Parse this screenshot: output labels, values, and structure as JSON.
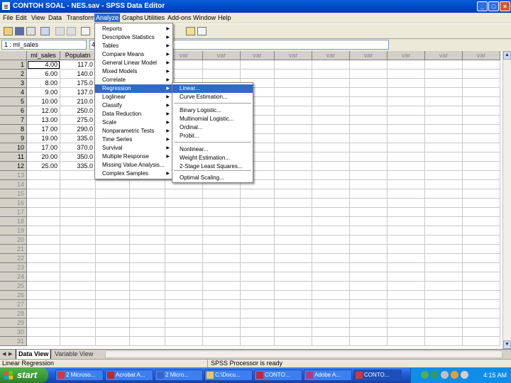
{
  "window": {
    "title": "CONTOH SOAL - NES.sav - SPSS Data Editor",
    "minimize": "_",
    "restore": "□",
    "close": "×"
  },
  "menubar": [
    "File",
    "Edit",
    "View",
    "Data",
    "Transform",
    "Analyze",
    "Graphs",
    "Utilities",
    "Add-ons",
    "Window",
    "Help"
  ],
  "active_menu": "Analyze",
  "cell_editor": {
    "ref": "1 : ml_sales",
    "value": "4"
  },
  "grid": {
    "columns": [
      "ml_sales",
      "Populatn",
      "var",
      "var",
      "var",
      "var",
      "var",
      "var",
      "var",
      "var",
      "var",
      "var",
      "var"
    ],
    "rows": [
      [
        "4.00",
        "117.0"
      ],
      [
        "6.00",
        "140.0"
      ],
      [
        "8.00",
        "175.0"
      ],
      [
        "9.00",
        "137.0"
      ],
      [
        "10.00",
        "210.0"
      ],
      [
        "12.00",
        "250.0"
      ],
      [
        "13.00",
        "275.0"
      ],
      [
        "17.00",
        "290.0"
      ],
      [
        "19.00",
        "335.0"
      ],
      [
        "17.00",
        "370.0"
      ],
      [
        "20.00",
        "350.0"
      ],
      [
        "25.00",
        "335.0"
      ]
    ],
    "row_numbers": [
      "1",
      "2",
      "3",
      "4",
      "5",
      "6",
      "7",
      "8",
      "9",
      "10",
      "11",
      "12",
      "13",
      "14",
      "15",
      "16",
      "17",
      "18",
      "19",
      "20",
      "21",
      "22",
      "23",
      "24",
      "25",
      "26",
      "27",
      "28",
      "29",
      "30",
      "31"
    ]
  },
  "analyze_menu": {
    "items": [
      "Reports",
      "Descriptive Statistics",
      "Tables",
      "Compare Means",
      "General Linear Model",
      "Mixed Models",
      "Correlate",
      "Regression",
      "Loglinear",
      "Classify",
      "Data Reduction",
      "Scale",
      "Nonparametric Tests",
      "Time Series",
      "Survival",
      "Multiple Response",
      "Missing Value Analysis...",
      "Complex Samples"
    ],
    "highlighted": "Regression"
  },
  "regression_menu": {
    "items": [
      "Linear...",
      "Curve Estimation...",
      "Binary Logistic...",
      "Multinomial Logistic...",
      "Ordinal...",
      "Probit...",
      "Nonlinear...",
      "Weight Estimation...",
      "2-Stage Least Squares...",
      "Optimal Scaling..."
    ],
    "highlighted": "Linear..."
  },
  "tabs": {
    "data_view": "Data View",
    "variable_view": "Variable View"
  },
  "status": {
    "left": "Linear Regression",
    "middle": "SPSS Processor  is ready"
  },
  "taskbar": {
    "start": "start",
    "tasks": [
      "2 Microso...",
      "Acrobat A...",
      "2 Micro...",
      "C:\\Docu...",
      "CONTO...",
      "Adobe A...",
      "CONTO..."
    ],
    "clock": "4:15 AM"
  },
  "colors": {
    "title_bar": "#0046c8",
    "menu_highlight": "#316ac5",
    "taskbar": "#245edb",
    "start_button": "#3a9a36"
  }
}
